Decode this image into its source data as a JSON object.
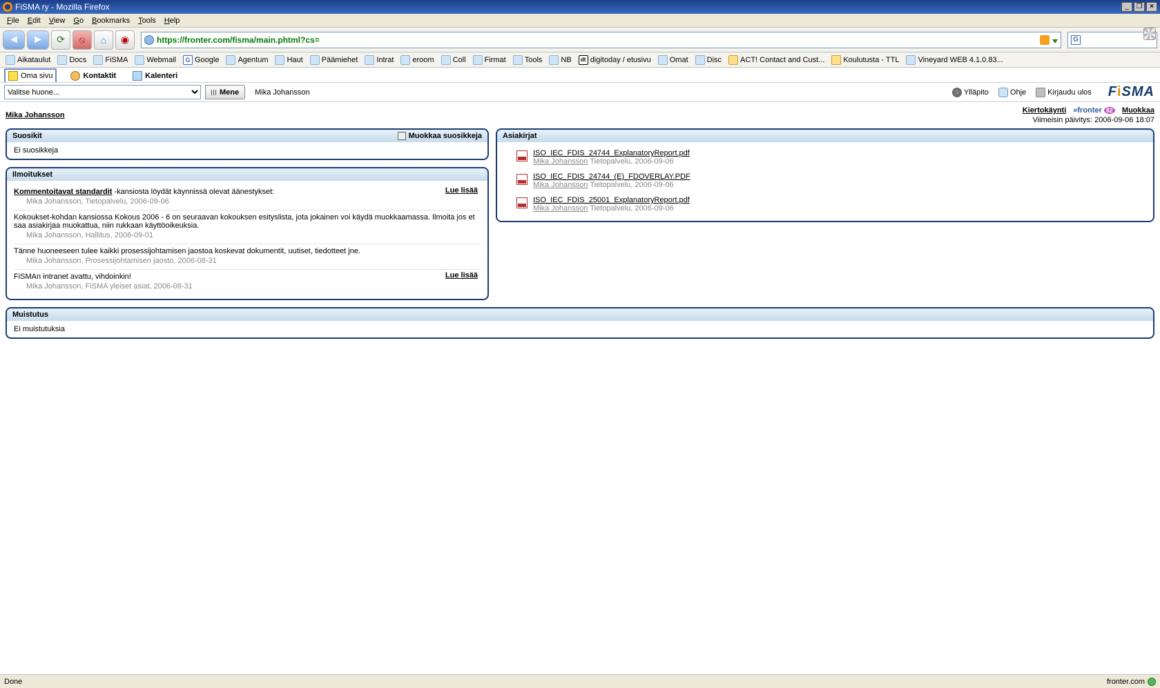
{
  "window": {
    "title": "FiSMA ry - Mozilla Firefox",
    "minimize": "_",
    "maximize": "❐",
    "close": "×"
  },
  "menubar": [
    "File",
    "Edit",
    "View",
    "Go",
    "Bookmarks",
    "Tools",
    "Help"
  ],
  "url": "https://fronter.com/fisma/main.phtml?cs=",
  "bookmarks": [
    {
      "label": "Aikataulut",
      "icon": "std"
    },
    {
      "label": "Docs",
      "icon": "std"
    },
    {
      "label": "FiSMA",
      "icon": "std"
    },
    {
      "label": "Webmail",
      "icon": "std"
    },
    {
      "label": "Google",
      "icon": "g"
    },
    {
      "label": "Agentum",
      "icon": "std"
    },
    {
      "label": "Haut",
      "icon": "std"
    },
    {
      "label": "Päämiehet",
      "icon": "std"
    },
    {
      "label": "Intrat",
      "icon": "std"
    },
    {
      "label": "eroom",
      "icon": "std"
    },
    {
      "label": "Coll",
      "icon": "std"
    },
    {
      "label": "Firmat",
      "icon": "std"
    },
    {
      "label": "Tools",
      "icon": "std"
    },
    {
      "label": "NB",
      "icon": "std"
    },
    {
      "label": "digitoday / etusivu",
      "icon": "dt"
    },
    {
      "label": "Omat",
      "icon": "std"
    },
    {
      "label": "Disc",
      "icon": "std"
    },
    {
      "label": "ACT! Contact and Cust...",
      "icon": "bulb"
    },
    {
      "label": "Koulutusta - TTL",
      "icon": "bulb"
    },
    {
      "label": "Vineyard WEB 4.1.0.83...",
      "icon": "std"
    }
  ],
  "apptabs": {
    "active": "Oma sivu",
    "items": [
      "Oma sivu",
      "Kontaktit",
      "Kalenteri"
    ]
  },
  "room": {
    "placeholder": "Valitse huone...",
    "go": "Mene",
    "user": "Mika Johansson"
  },
  "rightlinks": {
    "admin": "Ylläpito",
    "help": "Ohje",
    "logout": "Kirjaudu ulos"
  },
  "logo": "FiSMA",
  "page": {
    "user": "Mika Johansson",
    "tour": "Kiertokäynti",
    "fronter": "fronter",
    "edit": "Muokkaa",
    "updated": "Viimeisin päivitys: 2006-09-06 18:07"
  },
  "panels": {
    "favorites": {
      "title": "Suosikit",
      "edit": "Muokkaa suosikkeja",
      "empty": "Ei suosikkeja"
    },
    "announcements": {
      "title": "Ilmoitukset",
      "more": "Lue lisää",
      "items": [
        {
          "link": "Kommentoitavat standardit",
          "rest": " -kansiosta löydät käynnissä olevat äänestykset:",
          "meta": "Mika Johansson,  Tietopalvelu,  2006-09-06",
          "more": true
        },
        {
          "text": "Kokoukset-kohdan kansiossa Kokous 2006 - 6 on seuraavan kokouksen esityslista, jota jokainen voi käydä muokkaamassa. Ilmoita jos et saa asiakirjaa muokattua, niin rukkaan käyttöoikeuksia.",
          "meta": "Mika Johansson,  Hallitus,  2006-09-01",
          "more": false
        },
        {
          "text": "Tänne huoneeseen tulee kaikki prosessijohtamisen jaostoa koskevat dokumentit, uutiset, tiedotteet jne.",
          "meta": "Mika Johansson,  Prosessijohtamisen jaosto,  2006-08-31",
          "more": false
        },
        {
          "text": "FiSMAn intranet avattu, vihdoinkin!",
          "meta": "Mika Johansson,  FiSMA yleiset asiat,  2006-08-31",
          "more": true
        }
      ]
    },
    "documents": {
      "title": "Asiakirjat",
      "items": [
        {
          "name": "ISO_IEC_FDIS_24744_ExplanatoryReport.pdf",
          "author": "Mika Johansson",
          "meta": " Tietopalvelu, 2006-09-06"
        },
        {
          "name": "ISO_IEC_FDIS_24744_(E)_FDOVERLAY.PDF",
          "author": "Mika Johansson",
          "meta": " Tietopalvelu, 2006-09-06"
        },
        {
          "name": "ISO_IEC_FDIS_25001_ExplanatoryReport.pdf",
          "author": "Mika Johansson",
          "meta": " Tietopalvelu, 2006-09-06"
        }
      ]
    },
    "reminders": {
      "title": "Muistutus",
      "empty": "Ei muistutuksia"
    }
  },
  "status": {
    "left": "Done",
    "right": "fronter.com"
  }
}
